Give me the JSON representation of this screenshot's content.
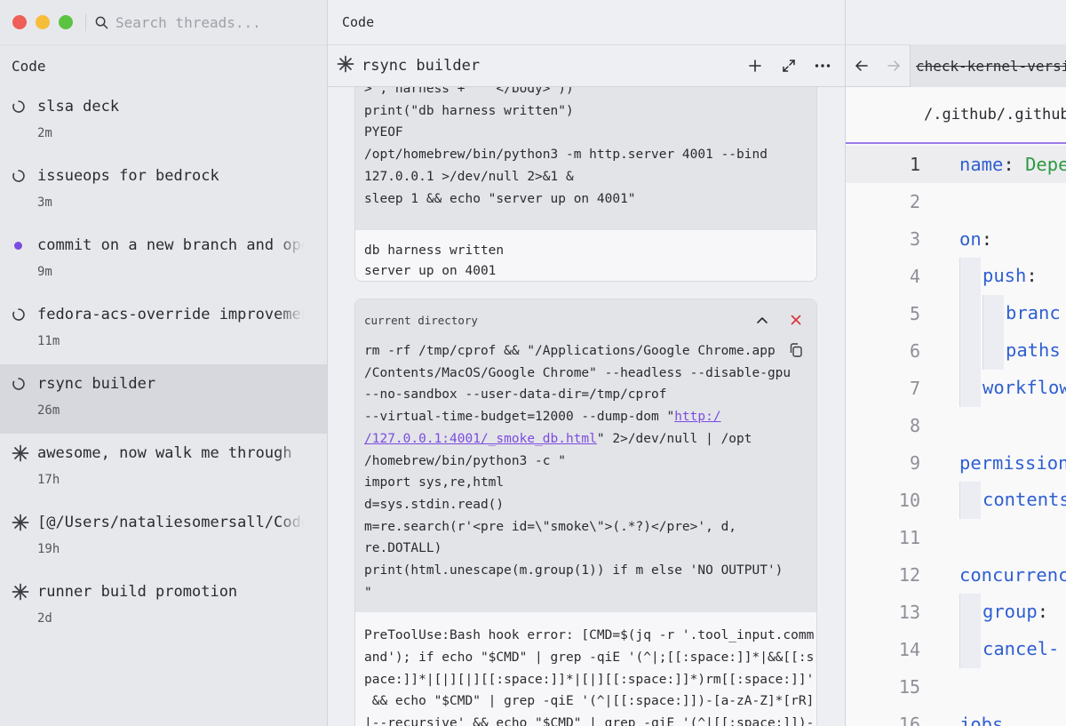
{
  "sidebar": {
    "search_placeholder": "Search threads...",
    "section_title": "Code",
    "threads": [
      {
        "title": "slsa deck",
        "time": "2m",
        "icon": "spinner-icon"
      },
      {
        "title": "issueops for bedrock",
        "time": "3m",
        "icon": "spinner-icon"
      },
      {
        "title": "commit on a new branch and open",
        "time": "9m",
        "icon": "unread-dot-icon"
      },
      {
        "title": "fedora-acs-override improvements",
        "time": "11m",
        "icon": "spinner-icon"
      },
      {
        "title": "rsync builder",
        "time": "26m",
        "icon": "spinner-icon"
      },
      {
        "title": "awesome, now walk me through it",
        "time": "17h",
        "icon": "sparkle-icon"
      },
      {
        "title": "[@/Users/nataliesomersall/Code",
        "time": "19h",
        "icon": "sparkle-icon"
      },
      {
        "title": "runner build promotion",
        "time": "2d",
        "icon": "sparkle-icon"
      }
    ]
  },
  "middle": {
    "tab_title": "Code",
    "thread_title": "rsync builder",
    "card1": {
      "code_lines": [
        ">', harness + '  </body>'))",
        "print(\"db harness written\")",
        "PYEOF",
        "/opt/homebrew/bin/python3 -m http.server 4001 --bind",
        "127.0.0.1 >/dev/null 2>&1 &",
        "sleep 1 && echo \"server up on 4001\""
      ],
      "output_lines": [
        "db harness written",
        "server up on 4001"
      ]
    },
    "card2": {
      "label": "current directory",
      "cmd_line_1": "rm -rf /tmp/cprof && \"/Applications/Google Chrome.app",
      "cmd_line_2": "/Contents/MacOS/Google Chrome\" --headless --disable-gpu",
      "cmd_line_3": "--no-sandbox --user-data-dir=/tmp/cprof",
      "cmd_line_4_pre": "--virtual-time-budget=12000 --dump-dom \"",
      "link_part_1": "http:/",
      "link_part_2": "/127.0.0.1:4001/_smoke_db.html",
      "cmd_line_5_post": "\" 2>/dev/null | /opt",
      "cmd_rest": [
        "/homebrew/bin/python3 -c \"",
        "import sys,re,html",
        "d=sys.stdin.read()",
        "m=re.search(r'<pre id=\\\"smoke\\\">(.*?)</pre>', d,",
        "re.DOTALL)",
        "print(html.unescape(m.group(1)) if m else 'NO OUTPUT')",
        "\""
      ],
      "error_lines": [
        "PreToolUse:Bash hook error: [CMD=$(jq -r '.tool_input.comm",
        "and'); if echo \"$CMD\" | grep -qiE '(^|;[[:space:]]*|&&[[:s",
        "pace:]]*|[|][|][[:space:]]*|[|][[:space:]]*)rm[[:space:]]'",
        " && echo \"$CMD\" | grep -qiE '(^|[[:space:]])-[a-zA-Z]*[rR]",
        "|--recursive' && echo \"$CMD\" | grep -qiE '(^|[[:space:]])-"
      ]
    }
  },
  "right": {
    "file_tab": "check-kernel-version.yml",
    "path": "/.github/.github/workflows",
    "lines": [
      {
        "n": "1",
        "key": "name",
        "pun": ": ",
        "val": "Depe"
      },
      {
        "n": "2"
      },
      {
        "n": "3",
        "key": "on",
        "pun": ":"
      },
      {
        "n": "4",
        "key": "push",
        "pun": ":"
      },
      {
        "n": "5",
        "key": "branc"
      },
      {
        "n": "6",
        "key": "paths"
      },
      {
        "n": "7",
        "key": "workflow"
      },
      {
        "n": "8"
      },
      {
        "n": "9",
        "key": "permission"
      },
      {
        "n": "10",
        "key": "contents"
      },
      {
        "n": "11"
      },
      {
        "n": "12",
        "key": "concurrency"
      },
      {
        "n": "13",
        "key": "group",
        "pun": ": "
      },
      {
        "n": "14",
        "key": "cancel-"
      },
      {
        "n": "15"
      },
      {
        "n": "16",
        "key": "jobs"
      }
    ]
  },
  "colors": {
    "accent": "#7b4ce0",
    "close": "#d8333a",
    "yaml_key": "#2f5fd0",
    "yaml_value": "#2d9a3f"
  }
}
